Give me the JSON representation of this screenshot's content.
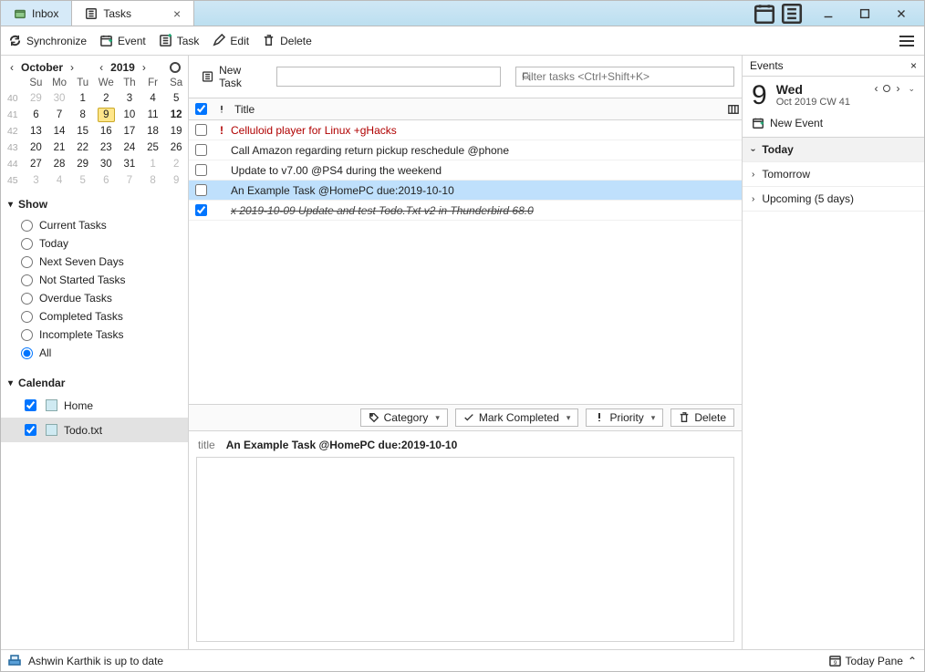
{
  "titlebar": {
    "tabs": [
      {
        "label": "Inbox",
        "active": false
      },
      {
        "label": "Tasks",
        "active": true
      }
    ]
  },
  "toolbar": {
    "synchronize": "Synchronize",
    "event": "Event",
    "task": "Task",
    "edit": "Edit",
    "delete": "Delete"
  },
  "calendar": {
    "month": "October",
    "year": "2019",
    "dayHeaders": [
      "Su",
      "Mo",
      "Tu",
      "We",
      "Th",
      "Fr",
      "Sa"
    ],
    "weeks": [
      {
        "wn": "40",
        "days": [
          {
            "d": "29",
            "dim": true
          },
          {
            "d": "30",
            "dim": true
          },
          {
            "d": "1"
          },
          {
            "d": "2"
          },
          {
            "d": "3"
          },
          {
            "d": "4"
          },
          {
            "d": "5"
          }
        ]
      },
      {
        "wn": "41",
        "days": [
          {
            "d": "6"
          },
          {
            "d": "7"
          },
          {
            "d": "8"
          },
          {
            "d": "9",
            "today": true
          },
          {
            "d": "10"
          },
          {
            "d": "11"
          },
          {
            "d": "12",
            "bold": true
          }
        ]
      },
      {
        "wn": "42",
        "days": [
          {
            "d": "13"
          },
          {
            "d": "14"
          },
          {
            "d": "15"
          },
          {
            "d": "16"
          },
          {
            "d": "17"
          },
          {
            "d": "18"
          },
          {
            "d": "19"
          }
        ]
      },
      {
        "wn": "43",
        "days": [
          {
            "d": "20"
          },
          {
            "d": "21"
          },
          {
            "d": "22"
          },
          {
            "d": "23"
          },
          {
            "d": "24"
          },
          {
            "d": "25"
          },
          {
            "d": "26"
          }
        ]
      },
      {
        "wn": "44",
        "days": [
          {
            "d": "27"
          },
          {
            "d": "28"
          },
          {
            "d": "29"
          },
          {
            "d": "30"
          },
          {
            "d": "31"
          },
          {
            "d": "1",
            "dim": true
          },
          {
            "d": "2",
            "dim": true
          }
        ]
      },
      {
        "wn": "45",
        "days": [
          {
            "d": "3",
            "dim": true
          },
          {
            "d": "4",
            "dim": true
          },
          {
            "d": "5",
            "dim": true
          },
          {
            "d": "6",
            "dim": true
          },
          {
            "d": "7",
            "dim": true
          },
          {
            "d": "8",
            "dim": true
          },
          {
            "d": "9",
            "dim": true
          }
        ]
      }
    ]
  },
  "show": {
    "heading": "Show",
    "options": [
      "Current Tasks",
      "Today",
      "Next Seven Days",
      "Not Started Tasks",
      "Overdue Tasks",
      "Completed Tasks",
      "Incomplete Tasks",
      "All"
    ],
    "selected": "All"
  },
  "calendars": {
    "heading": "Calendar",
    "items": [
      {
        "name": "Home",
        "checked": true,
        "selected": false
      },
      {
        "name": "Todo.txt",
        "checked": true,
        "selected": true
      }
    ]
  },
  "listbar": {
    "newTask": "New Task",
    "filterPlaceholder": "Filter tasks <Ctrl+Shift+K>"
  },
  "columns": {
    "title": "Title"
  },
  "tasks": [
    {
      "checked": false,
      "priority": true,
      "text": "Celluloid player for Linux +gHacks",
      "red": true
    },
    {
      "checked": false,
      "priority": false,
      "text": "Call Amazon regarding return pickup reschedule @phone"
    },
    {
      "checked": false,
      "priority": false,
      "text": "Update to v7.00 @PS4 during the weekend"
    },
    {
      "checked": false,
      "priority": false,
      "text": "An Example Task @HomePC due:2019-10-10",
      "selected": true
    },
    {
      "checked": true,
      "priority": false,
      "text": "x 2019-10-09 Update and test Todo.Txt v2 in Thunderbird 68.0",
      "done": true
    }
  ],
  "actions": {
    "category": "Category",
    "markCompleted": "Mark Completed",
    "priority": "Priority",
    "delete": "Delete"
  },
  "detail": {
    "label": "title",
    "text": "An Example Task @HomePC due:2019-10-10"
  },
  "eventsPane": {
    "heading": "Events",
    "dayNumber": "9",
    "weekday": "Wed",
    "subline": "Oct 2019   CW 41",
    "newEvent": "New Event",
    "sections": [
      {
        "label": "Today",
        "expanded": true
      },
      {
        "label": "Tomorrow",
        "expanded": false
      },
      {
        "label": "Upcoming (5 days)",
        "expanded": false
      }
    ]
  },
  "statusbar": {
    "status": "Ashwin Karthik is up to date",
    "todayPane": "Today Pane"
  }
}
